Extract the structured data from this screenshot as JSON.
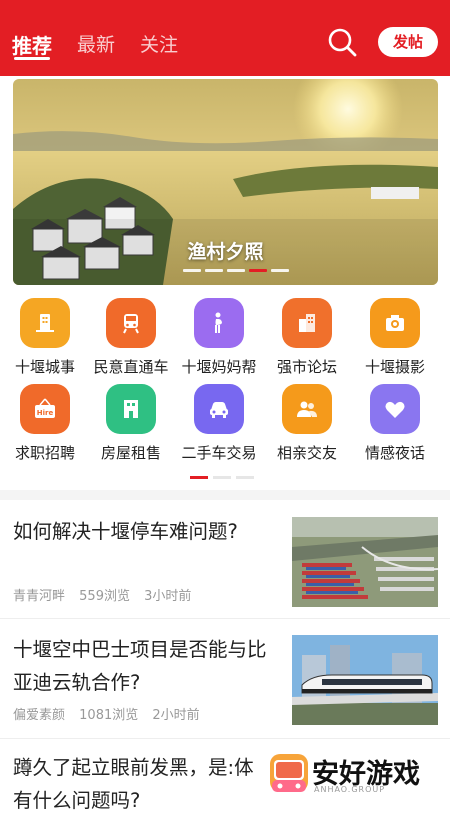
{
  "header": {
    "tabs": [
      {
        "label": "推荐",
        "active": true
      },
      {
        "label": "最新",
        "active": false
      },
      {
        "label": "关注",
        "active": false
      }
    ],
    "search_icon": "search-icon",
    "post_label": "发帖",
    "accent_color": "#e31e24"
  },
  "banner": {
    "title": "渔村夕照",
    "slides": 5,
    "active_slide": 4
  },
  "categories": [
    {
      "label": "十堰城事",
      "icon": "building-icon",
      "color": "#f5a623"
    },
    {
      "label": "民意直通车",
      "icon": "train-icon",
      "color": "#f06a2a"
    },
    {
      "label": "十堰妈妈帮",
      "icon": "pregnant-woman-icon",
      "color": "#9b6cf0"
    },
    {
      "label": "强市论坛",
      "icon": "office-icon",
      "color": "#f0702c"
    },
    {
      "label": "十堰摄影",
      "icon": "camera-icon",
      "color": "#f59a1b"
    },
    {
      "label": "求职招聘",
      "icon": "hire-sign-icon",
      "color": "#f06a2a"
    },
    {
      "label": "房屋租售",
      "icon": "house-icon",
      "color": "#2fc083"
    },
    {
      "label": "二手车交易",
      "icon": "car-icon",
      "color": "#7868f0"
    },
    {
      "label": "相亲交友",
      "icon": "people-icon",
      "color": "#f59a1b"
    },
    {
      "label": "情感夜话",
      "icon": "heart-icon",
      "color": "#8a76f0"
    }
  ],
  "category_pages": 3,
  "category_active_page": 1,
  "news": [
    {
      "title": "如何解决十堰停车难问题?",
      "author": "青青河畔",
      "views": "559浏览",
      "time": "3小时前",
      "thumb": "parking-lot-photo"
    },
    {
      "title": "十堰空中巴士项目是否能与比亚迪云轨合作?",
      "author": "偏爱素颜",
      "views": "1081浏览",
      "time": "2小时前",
      "thumb": "monorail-photo"
    },
    {
      "title": "蹲久了起立眼前发黑，是:体有什么问题吗?",
      "thumb": ""
    }
  ],
  "watermark": {
    "text": "安好游戏",
    "sub": "ANHAO.GROUP"
  }
}
